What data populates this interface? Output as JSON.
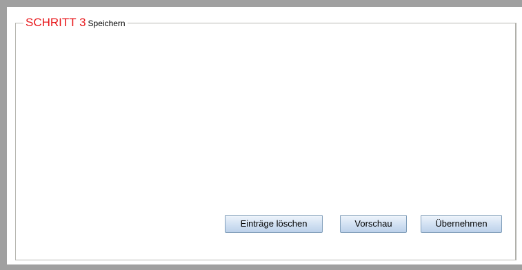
{
  "step": {
    "number_label": "SCHRITT 3",
    "title": "Speichern"
  },
  "actions": {
    "clear_label": "Einträge löschen",
    "preview_label": "Vorschau",
    "apply_label": "Übernehmen"
  }
}
